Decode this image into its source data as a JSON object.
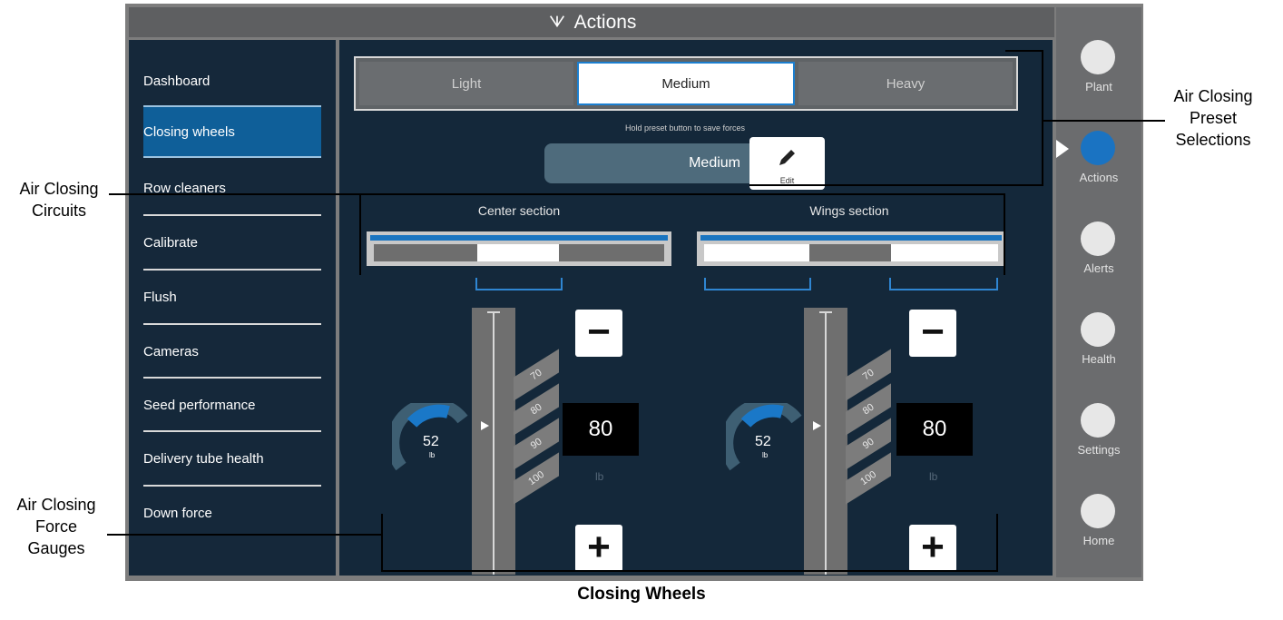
{
  "header": {
    "title": "Actions"
  },
  "menu": [
    {
      "label": "Dashboard",
      "active": false
    },
    {
      "label": "Closing wheels",
      "active": true
    },
    {
      "label": "Row cleaners",
      "active": false
    },
    {
      "label": "Calibrate",
      "active": false
    },
    {
      "label": "Flush",
      "active": false
    },
    {
      "label": "Cameras",
      "active": false
    },
    {
      "label": "Seed performance",
      "active": false
    },
    {
      "label": "Delivery tube health",
      "active": false
    },
    {
      "label": "Down force",
      "active": false
    }
  ],
  "presets": {
    "options": [
      "Light",
      "Medium",
      "Heavy"
    ],
    "selected": "Medium",
    "hint": "Hold preset button to save forces",
    "current": "Medium",
    "edit_label": "Edit"
  },
  "sections": {
    "center": {
      "title": "Center section",
      "dial_value": "52",
      "dial_unit": "lb",
      "dial_fill_fraction": 0.45,
      "ticks": [
        "70",
        "80",
        "90",
        "100"
      ],
      "setpoint": "80",
      "setpoint_unit": "lb"
    },
    "wings": {
      "title": "Wings section",
      "dial_value": "52",
      "dial_unit": "lb",
      "dial_fill_fraction": 0.45,
      "ticks": [
        "70",
        "80",
        "90",
        "100"
      ],
      "setpoint": "80",
      "setpoint_unit": "lb"
    }
  },
  "nav": [
    {
      "label": "Plant",
      "icon": "plant-icon"
    },
    {
      "label": "Actions",
      "icon": "actions-icon",
      "active": true
    },
    {
      "label": "Alerts",
      "icon": "alerts-icon"
    },
    {
      "label": "Health",
      "icon": "health-icon"
    },
    {
      "label": "Settings",
      "icon": "gear-icon"
    },
    {
      "label": "Home",
      "icon": "home-icon"
    }
  ],
  "annotations": {
    "preset": "Air Closing\nPreset\nSelections",
    "circuits": "Air Closing\nCircuits",
    "gauges": "Air Closing\nForce\nGauges"
  },
  "caption": "Closing Wheels",
  "colors": {
    "accent": "#1a75c0",
    "panel": "#14283a",
    "active_menu": "#0f5f99"
  }
}
